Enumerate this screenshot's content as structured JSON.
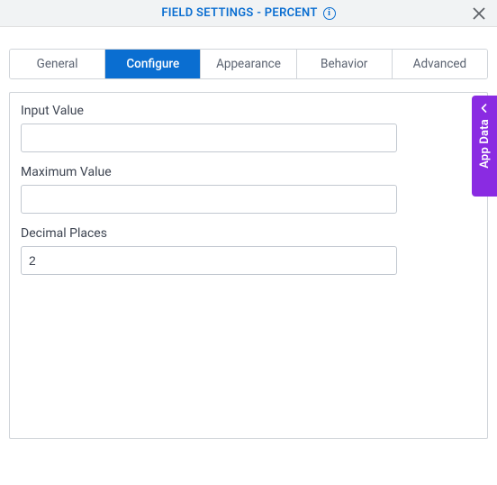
{
  "header": {
    "title": "FIELD SETTINGS - PERCENT"
  },
  "tabs": {
    "general": "General",
    "configure": "Configure",
    "appearance": "Appearance",
    "behavior": "Behavior",
    "advanced": "Advanced"
  },
  "form": {
    "input_value": {
      "label": "Input Value",
      "value": ""
    },
    "maximum_value": {
      "label": "Maximum Value",
      "value": ""
    },
    "decimal_places": {
      "label": "Decimal Places",
      "value": "2"
    }
  },
  "sidetab": {
    "label": "App Data"
  }
}
